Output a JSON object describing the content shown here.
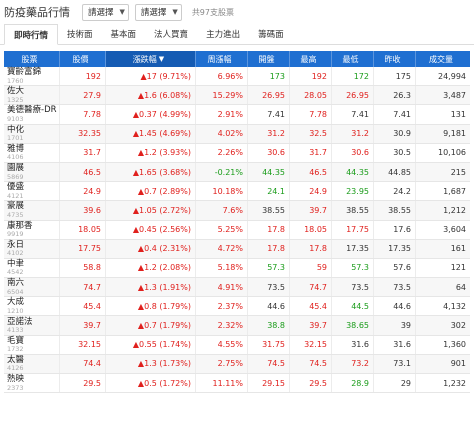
{
  "header": {
    "title": "防疫藥品行情",
    "select1": "請選擇",
    "select2": "請選擇",
    "count": "共97支股票"
  },
  "tabs": [
    "即時行情",
    "技術面",
    "基本面",
    "法人買賣",
    "主力進出",
    "籌碼面"
  ],
  "columns": [
    "股票",
    "股價",
    "漲跌幅",
    "周漲幅",
    "開盤",
    "最高",
    "最低",
    "昨收",
    "成交量"
  ],
  "rows": [
    {
      "name": "寶齡富錦",
      "code": "1760",
      "price": "192",
      "chg": "▲17 (9.71%)",
      "week": "6.96%",
      "open": "173",
      "high": "192",
      "low": "172",
      "prev": "175",
      "vol": "24,994",
      "pc": "up",
      "cc": "up",
      "wc": "up",
      "oc": "dn",
      "hc": "up",
      "lc": "dn"
    },
    {
      "name": "佐大",
      "code": "1325",
      "price": "27.9",
      "chg": "▲1.6 (6.08%)",
      "week": "15.29%",
      "open": "26.95",
      "high": "28.05",
      "low": "26.95",
      "prev": "26.3",
      "vol": "3,487",
      "pc": "up",
      "cc": "up",
      "wc": "up",
      "oc": "up",
      "hc": "up",
      "lc": "up"
    },
    {
      "name": "美德醫療-DR",
      "code": "9103",
      "price": "7.78",
      "chg": "▲0.37 (4.99%)",
      "week": "2.91%",
      "open": "7.41",
      "high": "7.78",
      "low": "7.41",
      "prev": "7.41",
      "vol": "131",
      "pc": "up",
      "cc": "up",
      "wc": "up",
      "oc": "flat",
      "hc": "up",
      "lc": "flat"
    },
    {
      "name": "中化",
      "code": "1701",
      "price": "32.35",
      "chg": "▲1.45 (4.69%)",
      "week": "4.02%",
      "open": "31.2",
      "high": "32.5",
      "low": "31.2",
      "prev": "30.9",
      "vol": "9,181",
      "pc": "up",
      "cc": "up",
      "wc": "up",
      "oc": "up",
      "hc": "up",
      "lc": "up"
    },
    {
      "name": "雅博",
      "code": "4106",
      "price": "31.7",
      "chg": "▲1.2 (3.93%)",
      "week": "2.26%",
      "open": "30.6",
      "high": "31.7",
      "low": "30.6",
      "prev": "30.5",
      "vol": "10,106",
      "pc": "up",
      "cc": "up",
      "wc": "up",
      "oc": "up",
      "hc": "up",
      "lc": "up"
    },
    {
      "name": "園展",
      "code": "5869",
      "price": "46.5",
      "chg": "▲1.65 (3.68%)",
      "week": "-0.21%",
      "open": "44.35",
      "high": "46.5",
      "low": "44.35",
      "prev": "44.85",
      "vol": "215",
      "pc": "up",
      "cc": "up",
      "wc": "dn",
      "oc": "dn",
      "hc": "up",
      "lc": "dn"
    },
    {
      "name": "優盛",
      "code": "4121",
      "price": "24.9",
      "chg": "▲0.7 (2.89%)",
      "week": "10.18%",
      "open": "24.1",
      "high": "24.9",
      "low": "23.95",
      "prev": "24.2",
      "vol": "1,687",
      "pc": "up",
      "cc": "up",
      "wc": "up",
      "oc": "dn",
      "hc": "up",
      "lc": "dn"
    },
    {
      "name": "豪展",
      "code": "4735",
      "price": "39.6",
      "chg": "▲1.05 (2.72%)",
      "week": "7.6%",
      "open": "38.55",
      "high": "39.7",
      "low": "38.55",
      "prev": "38.55",
      "vol": "1,212",
      "pc": "up",
      "cc": "up",
      "wc": "up",
      "oc": "flat",
      "hc": "up",
      "lc": "flat"
    },
    {
      "name": "康那香",
      "code": "9919",
      "price": "18.05",
      "chg": "▲0.45 (2.56%)",
      "week": "5.25%",
      "open": "17.8",
      "high": "18.05",
      "low": "17.75",
      "prev": "17.6",
      "vol": "3,604",
      "pc": "up",
      "cc": "up",
      "wc": "up",
      "oc": "up",
      "hc": "up",
      "lc": "up"
    },
    {
      "name": "永日",
      "code": "4102",
      "price": "17.75",
      "chg": "▲0.4 (2.31%)",
      "week": "4.72%",
      "open": "17.8",
      "high": "17.8",
      "low": "17.35",
      "prev": "17.35",
      "vol": "161",
      "pc": "up",
      "cc": "up",
      "wc": "up",
      "oc": "up",
      "hc": "up",
      "lc": "flat"
    },
    {
      "name": "中聿",
      "code": "4542",
      "price": "58.8",
      "chg": "▲1.2 (2.08%)",
      "week": "5.18%",
      "open": "57.3",
      "high": "59",
      "low": "57.3",
      "prev": "57.6",
      "vol": "121",
      "pc": "up",
      "cc": "up",
      "wc": "up",
      "oc": "dn",
      "hc": "up",
      "lc": "dn"
    },
    {
      "name": "南六",
      "code": "6504",
      "price": "74.7",
      "chg": "▲1.3 (1.91%)",
      "week": "4.91%",
      "open": "73.5",
      "high": "74.7",
      "low": "73.5",
      "prev": "73.5",
      "vol": "64",
      "pc": "up",
      "cc": "up",
      "wc": "up",
      "oc": "flat",
      "hc": "up",
      "lc": "flat"
    },
    {
      "name": "大成",
      "code": "1210",
      "price": "45.4",
      "chg": "▲0.8 (1.79%)",
      "week": "2.37%",
      "open": "44.6",
      "high": "45.4",
      "low": "44.5",
      "prev": "44.6",
      "vol": "4,132",
      "pc": "up",
      "cc": "up",
      "wc": "up",
      "oc": "flat",
      "hc": "up",
      "lc": "dn"
    },
    {
      "name": "亞諾法",
      "code": "4133",
      "price": "39.7",
      "chg": "▲0.7 (1.79%)",
      "week": "2.32%",
      "open": "38.8",
      "high": "39.7",
      "low": "38.65",
      "prev": "39",
      "vol": "302",
      "pc": "up",
      "cc": "up",
      "wc": "up",
      "oc": "dn",
      "hc": "up",
      "lc": "dn"
    },
    {
      "name": "毛寶",
      "code": "1732",
      "price": "32.15",
      "chg": "▲0.55 (1.74%)",
      "week": "4.55%",
      "open": "31.75",
      "high": "32.15",
      "low": "31.6",
      "prev": "31.6",
      "vol": "1,360",
      "pc": "up",
      "cc": "up",
      "wc": "up",
      "oc": "up",
      "hc": "up",
      "lc": "flat"
    },
    {
      "name": "太醫",
      "code": "4126",
      "price": "74.4",
      "chg": "▲1.3 (1.73%)",
      "week": "2.75%",
      "open": "74.5",
      "high": "74.5",
      "low": "73.2",
      "prev": "73.1",
      "vol": "901",
      "pc": "up",
      "cc": "up",
      "wc": "up",
      "oc": "up",
      "hc": "up",
      "lc": "up"
    },
    {
      "name": "熱映",
      "code": "2373",
      "price": "29.5",
      "chg": "▲0.5 (1.72%)",
      "week": "11.11%",
      "open": "29.15",
      "high": "29.5",
      "low": "28.9",
      "prev": "29",
      "vol": "1,232",
      "pc": "up",
      "cc": "up",
      "wc": "up",
      "oc": "up",
      "hc": "up",
      "lc": "dn"
    }
  ]
}
